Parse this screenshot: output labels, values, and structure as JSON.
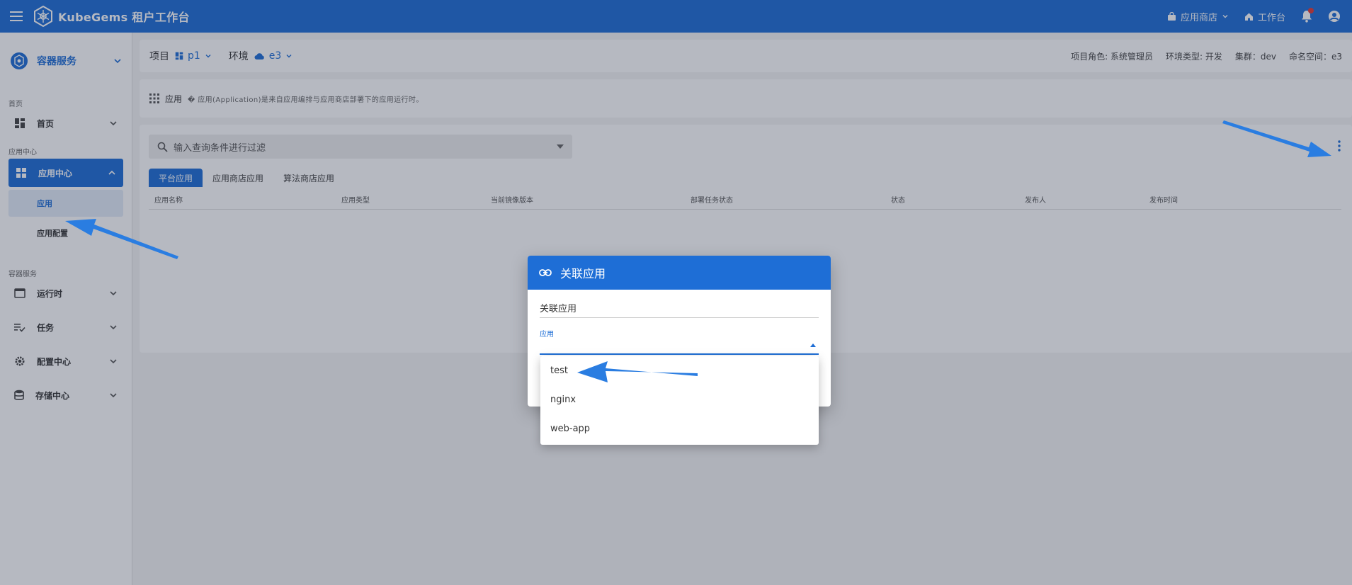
{
  "appbar": {
    "title": "KubeGems 租户工作台",
    "app_store": "应用商店",
    "workbench": "工作台"
  },
  "sidebar": {
    "header": "容器服务",
    "sections": {
      "home": "首页",
      "app_center": "应用中心",
      "container": "容器服务"
    },
    "items": {
      "home": "首页",
      "app_center": "应用中心",
      "app": "应用",
      "app_config": "应用配置",
      "runtime": "运行时",
      "tasks": "任务",
      "config_center": "配置中心",
      "storage_center": "存储中心"
    }
  },
  "toolbar": {
    "project_label": "项目",
    "project_value": "p1",
    "env_label": "环境",
    "env_value": "e3",
    "meta": [
      "项目角色: 系统管理员",
      "环境类型: 开发",
      "集群：dev",
      "命名空间：e3"
    ]
  },
  "breadcrumb": {
    "title": "应用",
    "description": "� 应用(Application)是来自应用编排与应用商店部署下的应用运行时。"
  },
  "content": {
    "search_placeholder": "输入查询条件进行过滤",
    "tabs": [
      "平台应用",
      "应用商店应用",
      "算法商店应用"
    ],
    "columns": [
      "应用名称",
      "应用类型",
      "当前镜像版本",
      "部署任务状态",
      "状态",
      "发布人",
      "发布时间"
    ]
  },
  "dialog": {
    "title": "关联应用",
    "field_a_value": "关联应用",
    "field_b_label": "应用",
    "options": [
      "test",
      "nginx",
      "web-app"
    ]
  },
  "colors": {
    "primary": "#1e6ed6",
    "annotation_arrow": "#2a7de1"
  }
}
